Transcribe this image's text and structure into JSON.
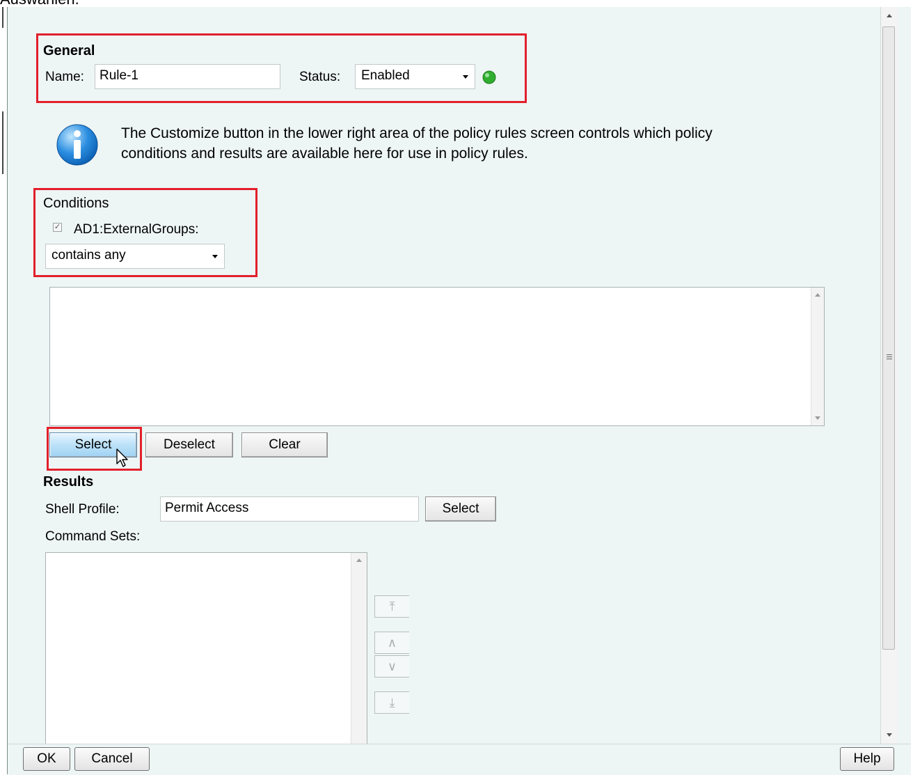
{
  "page_caption": "Auswählen.",
  "general": {
    "title": "General",
    "name_label": "Name:",
    "name_value": "Rule-1",
    "status_label": "Status:",
    "status_value": "Enabled",
    "status_color": "#2fae2f"
  },
  "info": {
    "text_line1": "The Customize button in the lower right area of the policy rules screen controls which policy",
    "text_line2": "conditions and results are available here for use in policy rules."
  },
  "conditions": {
    "title": "Conditions",
    "checkbox_label": "AD1:ExternalGroups:",
    "checked": true,
    "operator_value": "contains any",
    "select_button": "Select",
    "deselect_button": "Deselect",
    "clear_button": "Clear"
  },
  "results": {
    "title": "Results",
    "shell_profile_label": "Shell Profile:",
    "shell_profile_value": "Permit Access",
    "shell_select_button": "Select",
    "command_sets_label": "Command Sets:"
  },
  "footer": {
    "ok_button": "OK",
    "cancel_button": "Cancel",
    "help_button": "Help"
  },
  "colors": {
    "highlight_border": "#e2202b",
    "panel_background": "#eef5f5"
  }
}
